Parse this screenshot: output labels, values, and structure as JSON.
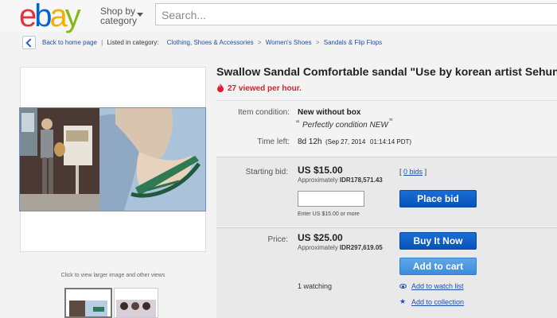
{
  "header": {
    "logo_letters": [
      "e",
      "b",
      "a",
      "y"
    ],
    "logo_colors": [
      "#e53238",
      "#0064d2",
      "#f5af02",
      "#86b817"
    ],
    "shop_by_line1": "Shop by",
    "shop_by_line2": "category",
    "search_placeholder": "Search..."
  },
  "breadcrumb": {
    "back_label": "Back to home page",
    "separator": "|",
    "listed_label": "Listed in category:",
    "items": [
      "Clothing, Shoes & Accessories",
      "Women's Shoes",
      "Sandals & Flip Flops"
    ],
    "arrow": ">"
  },
  "gallery": {
    "hint": "Click to view larger image and other views"
  },
  "listing": {
    "title": "Swallow Sandal Comfortable sandal \"Use by korean artist Sehun\"",
    "viewed": "27 viewed per hour."
  },
  "details": {
    "condition_label": "Item condition:",
    "condition_value": "New without box",
    "condition_quote_open": "“",
    "condition_note": "Perfectly condition NEW",
    "condition_quote_close": "”",
    "time_left_label": "Time left:",
    "time_left_value": "8d 12h",
    "time_left_date": "(Sep 27, 2014",
    "time_left_time": "01:14:14 PDT)"
  },
  "bid": {
    "starting_bid_label": "Starting bid:",
    "starting_price": "US $15.00",
    "approx_prefix": "Approximately",
    "approx_value": "IDR178,571.43",
    "bids_open": "[",
    "bids_link": "0 bids",
    "bids_close": "]",
    "enter_hint": "Enter US $15.00 or more",
    "place_bid_label": "Place bid"
  },
  "buy": {
    "price_label": "Price:",
    "price": "US $25.00",
    "approx_prefix": "Approximately",
    "approx_value": "IDR297,619.05",
    "buy_now_label": "Buy It Now",
    "add_to_cart_label": "Add to cart",
    "watching": "1 watching",
    "watch_list_link": "Add to watch list",
    "collection_link": "Add to collection"
  },
  "colors": {
    "link_blue": "#1e4eb0",
    "alert_red": "#dd1e31",
    "button_blue": "#0654ba"
  }
}
